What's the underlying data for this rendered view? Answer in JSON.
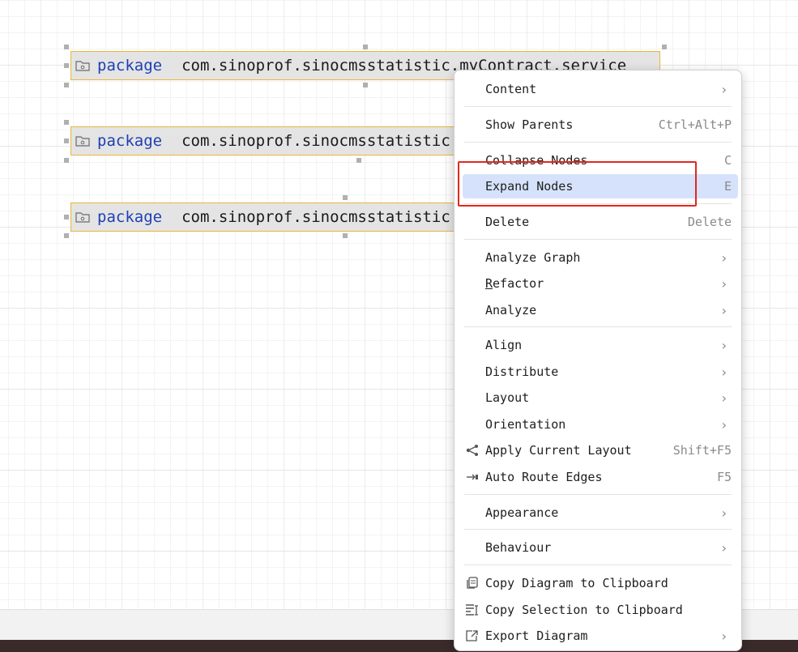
{
  "nodes": [
    {
      "keyword": "package",
      "name": "com.sinoprof.sinocmsstatistic.myContract.service"
    },
    {
      "keyword": "package",
      "name": "com.sinoprof.sinocmsstatistic"
    },
    {
      "keyword": "package",
      "name": "com.sinoprof.sinocmsstatistic"
    }
  ],
  "menu": {
    "content": "Content",
    "show_parents": "Show Parents",
    "show_parents_sc": "Ctrl+Alt+P",
    "collapse_nodes": "Collapse Nodes",
    "collapse_nodes_sc": "C",
    "expand_nodes": "Expand Nodes",
    "expand_nodes_sc": "E",
    "delete": "Delete",
    "delete_sc": "Delete",
    "analyze_graph": "Analyze Graph",
    "refactor_r": "R",
    "refactor_rest": "efactor",
    "analyze": "Analyze",
    "align": "Align",
    "distribute": "Distribute",
    "layout": "Layout",
    "orientation": "Orientation",
    "apply_layout": "Apply Current Layout",
    "apply_layout_sc": "Shift+F5",
    "auto_route": "Auto Route Edges",
    "auto_route_sc": "F5",
    "appearance": "Appearance",
    "behaviour": "Behaviour",
    "copy_diagram": "Copy Diagram to Clipboard",
    "copy_selection": "Copy Selection to Clipboard",
    "export_diagram": "Export Diagram",
    "arrow": "›"
  },
  "colors": {
    "keyword": "#1f3fb5",
    "node_border": "#e9b73a",
    "selected_bg": "#d6e2fc",
    "annotation": "#e0281e"
  }
}
